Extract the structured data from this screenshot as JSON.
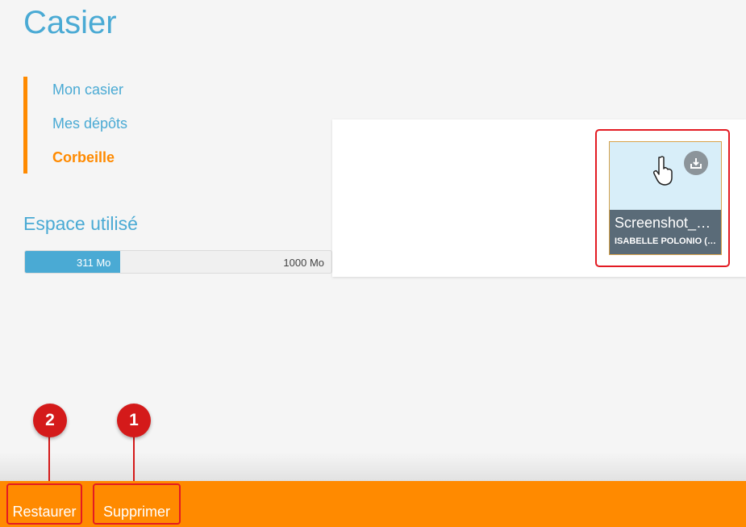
{
  "page": {
    "title": "Casier"
  },
  "nav": {
    "items": [
      {
        "label": "Mon casier",
        "active": false
      },
      {
        "label": "Mes dépôts",
        "active": false
      },
      {
        "label": "Corbeille",
        "active": true
      }
    ]
  },
  "storage": {
    "title": "Espace utilisé",
    "used_label": "311 Mo",
    "total_label": "1000 Mo",
    "used_fraction": 0.311,
    "fill_color": "#4aaad4"
  },
  "file_card": {
    "name": "Screenshot_2…",
    "owner": "ISABELLE POLONIO (…",
    "action_icon": "download-tray-icon",
    "pointer_icon": "hand-pointer-icon"
  },
  "action_bar": {
    "restore_label": "Restaurer",
    "delete_label": "Supprimer",
    "color": "#ff8a00"
  },
  "callouts": {
    "restore_number": "2",
    "delete_number": "1",
    "color": "#d41a1a"
  },
  "colors": {
    "accent_blue": "#4aaad4",
    "accent_orange": "#ff8a00",
    "highlight_red": "#e31b23"
  }
}
